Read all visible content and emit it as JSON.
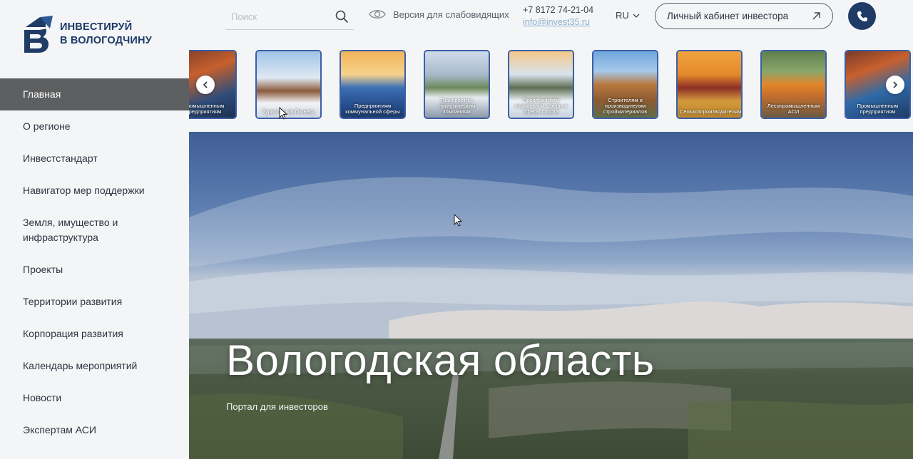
{
  "logo": {
    "line1": "Инвестируй",
    "line2": "в Вологодчину"
  },
  "sidebar": {
    "items": [
      {
        "label": "Главная",
        "active": true
      },
      {
        "label": "О регионе"
      },
      {
        "label": "Инвестстандарт"
      },
      {
        "label": "Навигатор мер поддержки"
      },
      {
        "label": "Земля, имущество и инфраструктура"
      },
      {
        "label": "Проекты"
      },
      {
        "label": "Территории развития"
      },
      {
        "label": "Корпорация развития"
      },
      {
        "label": "Календарь мероприятий"
      },
      {
        "label": "Новости"
      },
      {
        "label": "Экспертам АСИ"
      }
    ]
  },
  "header": {
    "search_placeholder": "Поиск",
    "vision_label": "Версия для слабовидящих",
    "phone": "+7 8172 74-21-04",
    "email": "info@invest35.ru",
    "lang": "RU",
    "cabinet_label": "Личный кабинет инвестора"
  },
  "carousel": {
    "cards": [
      {
        "label": "Промышленным предприятиям"
      },
      {
        "label": "Туристскому бизнесу"
      },
      {
        "label": "Предприятиям коммунальной сферы"
      },
      {
        "label": "Транспортно-логистическим компаниям"
      },
      {
        "label": "Предприятиям социальной сферы и сферы спорта"
      },
      {
        "label": "Строителям и производителям стройматериалов"
      },
      {
        "label": "Сельхозпроизводителям"
      },
      {
        "label": "Лесопромышленным АСИ"
      },
      {
        "label": "Промышленным предприятиям"
      }
    ]
  },
  "hero": {
    "title": "Вологодская область",
    "subtitle": "Портал для инвесторов"
  },
  "colors": {
    "brand": "#1f3b66",
    "active_nav": "#5e5f61",
    "card_border": "#3b5fa8"
  }
}
